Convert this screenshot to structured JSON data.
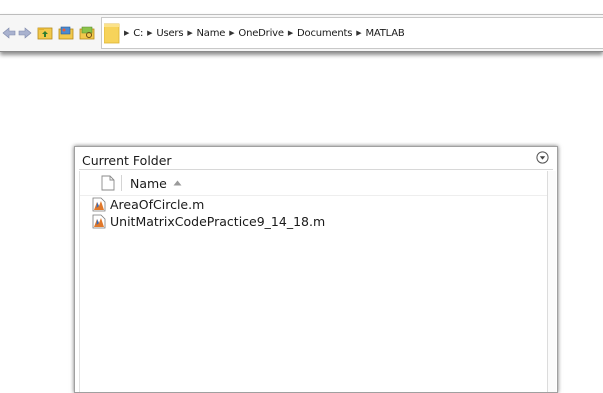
{
  "toolbar": {
    "icons": [
      "back-arrow-icon",
      "forward-arrow-icon",
      "up-folder-icon",
      "browse-folder-icon",
      "search-folder-icon",
      "folder-icon"
    ],
    "breadcrumbs": [
      "C:",
      "Users",
      "Name",
      "OneDrive",
      "Documents",
      "MATLAB"
    ]
  },
  "panel": {
    "title": "Current Folder",
    "column_header": "Name",
    "sort_direction": "ascending",
    "files": [
      {
        "name": "AreaOfCircle.m",
        "icon": "matlab-script-icon"
      },
      {
        "name": "UnitMatrixCodePractice9_14_18.m",
        "icon": "matlab-script-icon"
      }
    ]
  },
  "colors": {
    "nav_arrow": "#9aa6c8",
    "folder_yellow": "#f4c542",
    "matlab_orange": "#e0782a",
    "matlab_blue": "#3b6bb5"
  }
}
